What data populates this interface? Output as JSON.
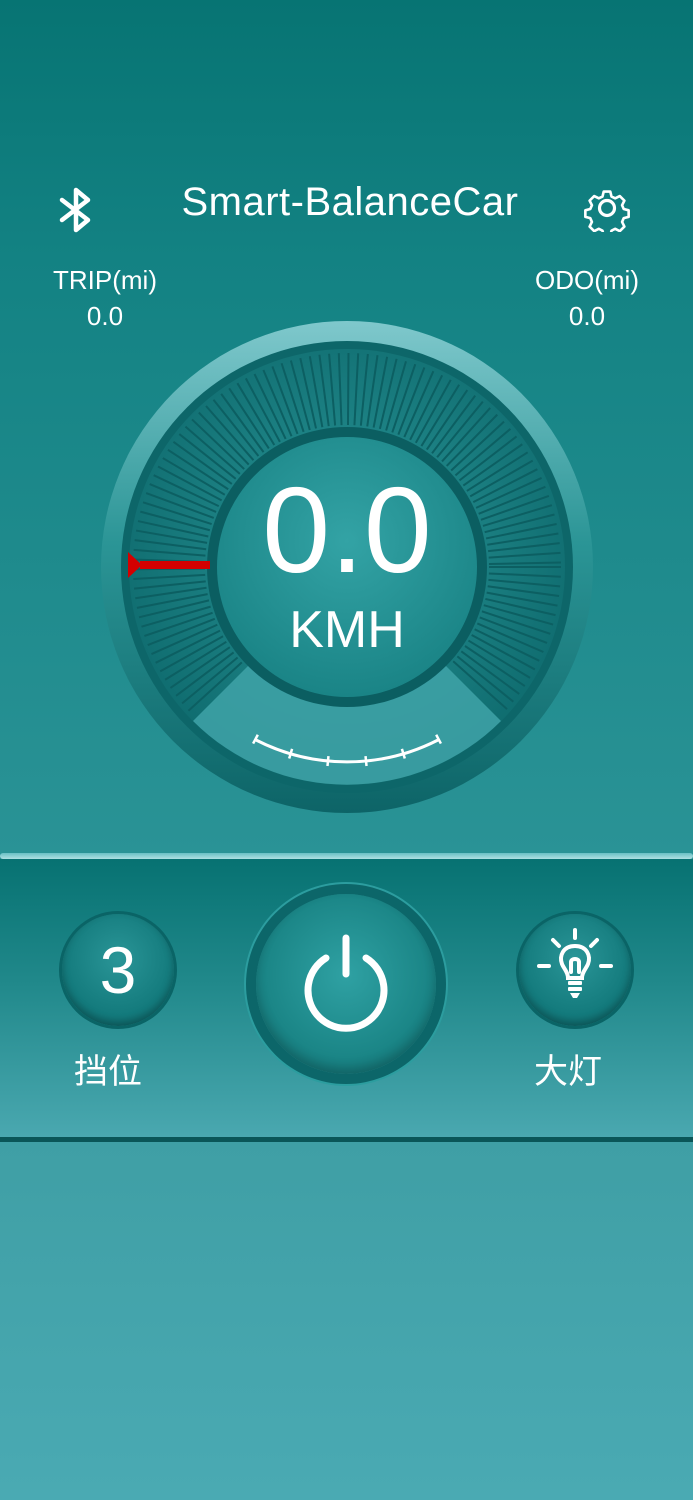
{
  "header": {
    "title": "Smart-BalanceCar",
    "bluetooth_icon": "bluetooth-icon",
    "settings_icon": "gear-icon"
  },
  "stats": {
    "trip_label": "TRIP(mi)",
    "trip_value": "0.0",
    "odo_label": "ODO(mi)",
    "odo_value": "0.0"
  },
  "speedometer": {
    "speed": "0.0",
    "unit": "KMH",
    "needle_color": "#d40000",
    "speed_fraction": 0
  },
  "controls": {
    "gear_value": "3",
    "gear_label": "挡位",
    "power_icon": "power-icon",
    "light_icon": "light-bulb-icon",
    "light_label": "大灯"
  },
  "colors": {
    "primary": "#077474",
    "accent_light": "#4aaab3",
    "text": "#ffffff"
  }
}
